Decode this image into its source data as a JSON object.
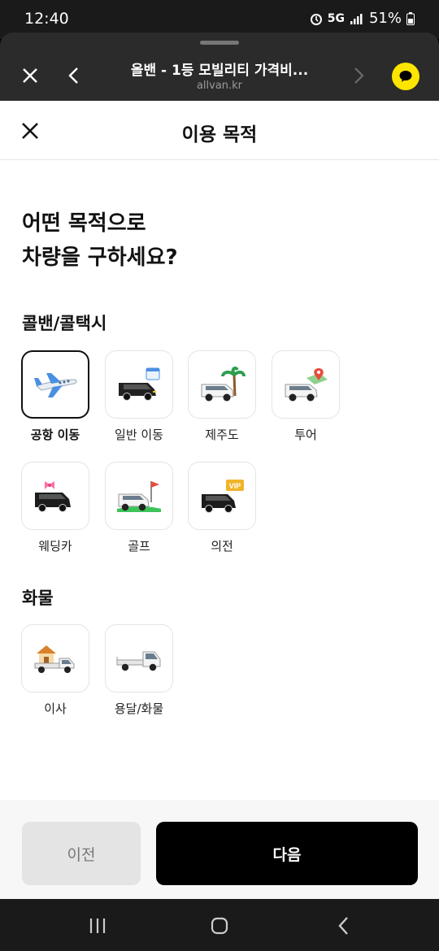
{
  "status_bar": {
    "time": "12:40",
    "network": "5G",
    "battery": "51%"
  },
  "browser": {
    "title": "올밴 - 1등 모빌리티 가격비...",
    "url": "allvan.kr"
  },
  "header": {
    "title": "이용 목적"
  },
  "question": {
    "line1": "어떤 목적으로",
    "line2": "차량을 구하세요?"
  },
  "sections": {
    "van": {
      "title": "콜밴/콜택시",
      "items": [
        {
          "label": "공항 이동",
          "icon": "airplane-icon",
          "selected": true
        },
        {
          "label": "일반 이동",
          "icon": "van-calendar-icon"
        },
        {
          "label": "제주도",
          "icon": "van-palm-tree-icon"
        },
        {
          "label": "투어",
          "icon": "van-map-pin-icon"
        },
        {
          "label": "웨딩카",
          "icon": "van-ribbon-icon"
        },
        {
          "label": "골프",
          "icon": "van-golf-flag-icon"
        },
        {
          "label": "의전",
          "icon": "van-vip-icon"
        }
      ]
    },
    "cargo": {
      "title": "화물",
      "items": [
        {
          "label": "이사",
          "icon": "moving-truck-icon"
        },
        {
          "label": "용달/화물",
          "icon": "cargo-truck-icon"
        }
      ]
    }
  },
  "buttons": {
    "prev": "이전",
    "next": "다음"
  }
}
